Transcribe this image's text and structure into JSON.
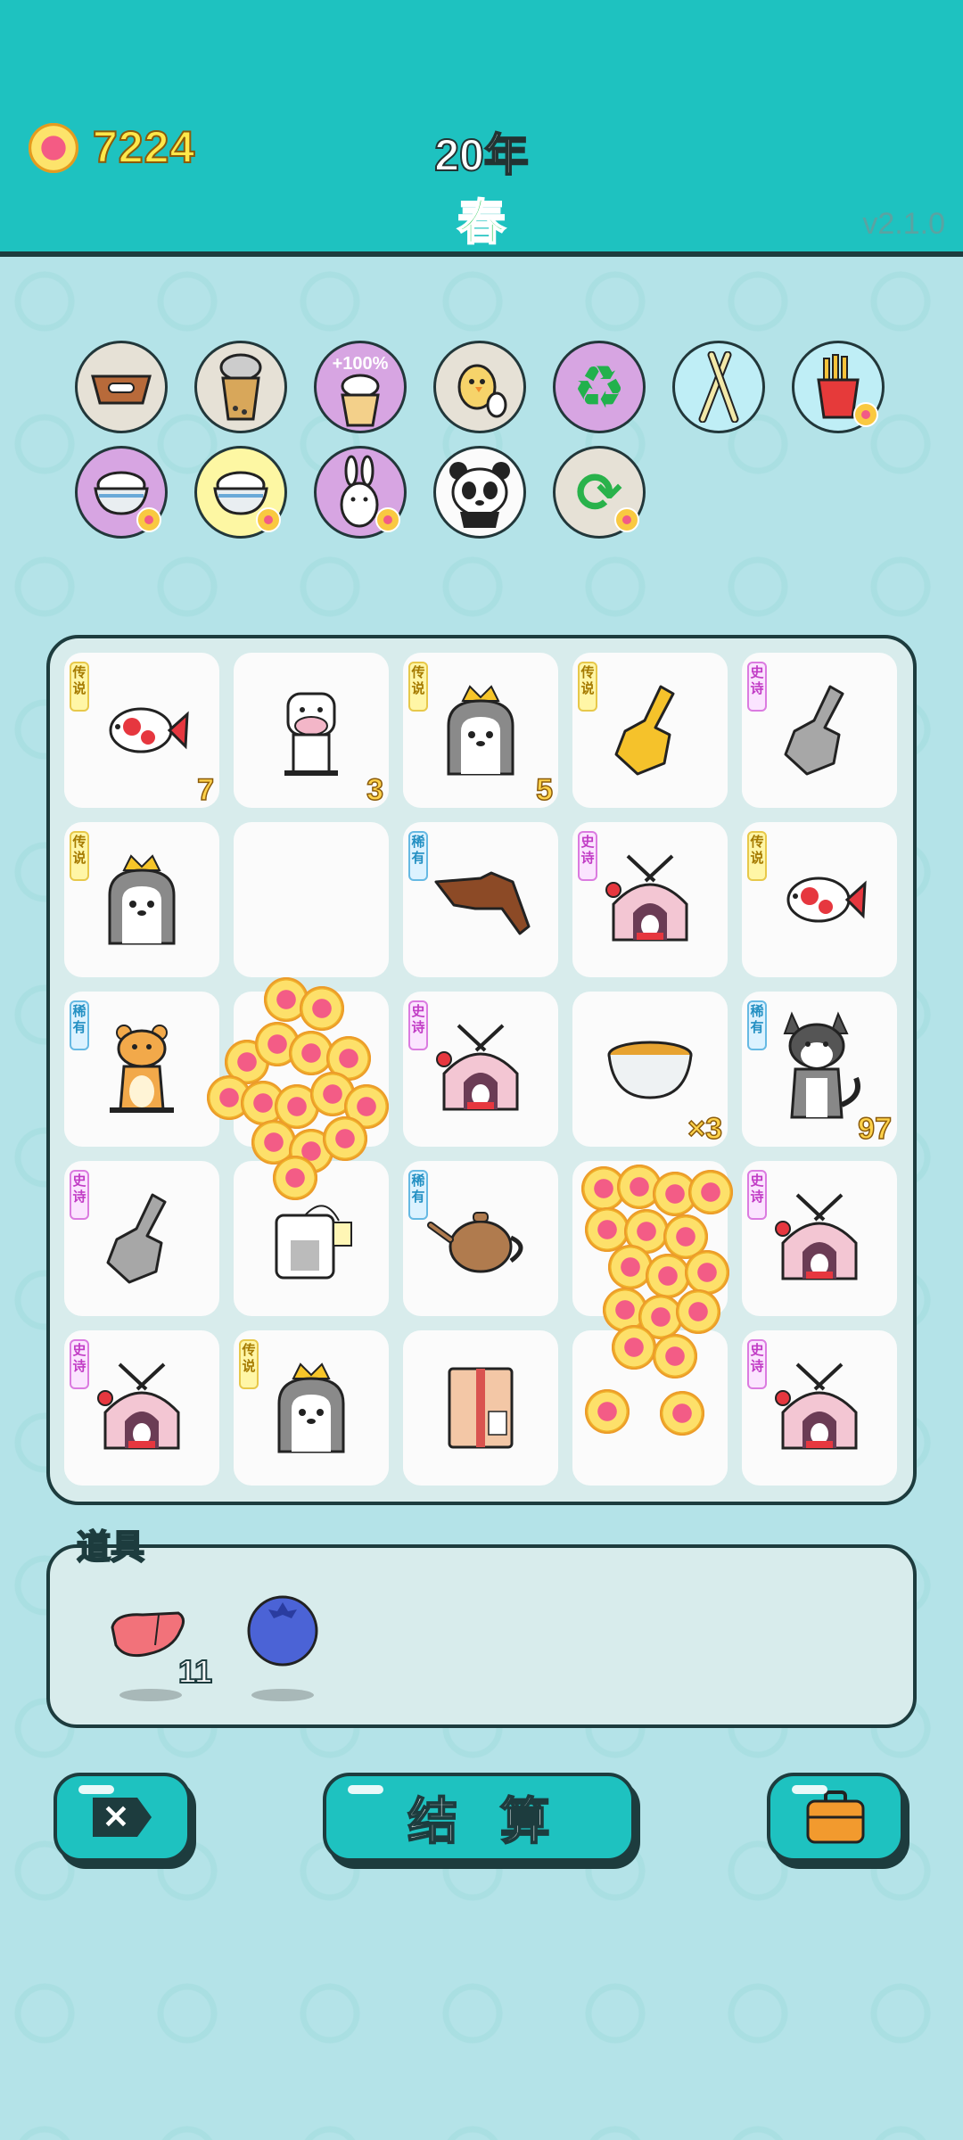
{
  "header": {
    "coins": "7224",
    "year": "20年",
    "season": "春",
    "version": "v2.1.0",
    "colors": {
      "header_bg": "#1ec2c0",
      "season": "#13c84a",
      "coins": "#ffe84a"
    }
  },
  "item_row_1": [
    {
      "icon": "pet-food-bowl-icon"
    },
    {
      "icon": "boba-tea-icon"
    },
    {
      "icon": "boba-tea-boost-icon",
      "label": "+100%"
    },
    {
      "icon": "chick-egg-icon"
    },
    {
      "icon": "recycle-icon"
    },
    {
      "icon": "chopsticks-icon"
    },
    {
      "icon": "fries-icon"
    }
  ],
  "item_row_2": [
    {
      "icon": "rice-bowl-icon"
    },
    {
      "icon": "rice-bowl-gold-icon"
    },
    {
      "icon": "bunny-icon"
    },
    {
      "icon": "panda-icon"
    },
    {
      "icon": "refresh-icon"
    }
  ],
  "rarity_labels": {
    "legend": "传说",
    "epic": "史诗",
    "rare": "稀有"
  },
  "board": [
    {
      "icon": "koi-fish-icon",
      "tag": "传说",
      "count": "7"
    },
    {
      "icon": "cow-icon",
      "count": "3"
    },
    {
      "icon": "crowned-husky-icon",
      "tag": "传说",
      "count": "5"
    },
    {
      "icon": "gold-pointing-hand-icon",
      "tag": "传说"
    },
    {
      "icon": "gray-pointing-hand-icon",
      "tag": "史诗"
    },
    {
      "icon": "crowned-husky-icon",
      "tag": "传说"
    },
    {
      "icon": "empty"
    },
    {
      "icon": "brown-pointing-hand-icon",
      "tag": "稀有"
    },
    {
      "icon": "bunny-house-icon",
      "tag": "史诗"
    },
    {
      "icon": "koi-fish-icon",
      "tag": "传说"
    },
    {
      "icon": "tiger-icon",
      "tag": "稀有"
    },
    {
      "icon": "coin-burst"
    },
    {
      "icon": "bunny-house-icon",
      "tag": "史诗"
    },
    {
      "icon": "tea-bowl-icon",
      "count": "×3"
    },
    {
      "icon": "husky-icon",
      "tag": "稀有",
      "count": "97"
    },
    {
      "icon": "gray-pointing-hand-icon",
      "tag": "史诗"
    },
    {
      "icon": "tea-bag-icon"
    },
    {
      "icon": "teapot-icon",
      "tag": "稀有"
    },
    {
      "icon": "coin-burst"
    },
    {
      "icon": "bunny-house-icon",
      "tag": "史诗"
    },
    {
      "icon": "bunny-house-icon",
      "tag": "史诗"
    },
    {
      "icon": "crowned-husky-icon",
      "tag": "传说"
    },
    {
      "icon": "parcel-box-icon"
    },
    {
      "icon": "coin-burst"
    },
    {
      "icon": "bunny-house-icon",
      "tag": "史诗"
    }
  ],
  "tools": {
    "title": "道具",
    "items": [
      {
        "icon": "liver-icon",
        "count": "11"
      },
      {
        "icon": "blueberry-icon"
      }
    ]
  },
  "buttons": {
    "settle_label": "结 算",
    "exit_icon": "close-icon",
    "bag_icon": "briefcase-icon"
  }
}
